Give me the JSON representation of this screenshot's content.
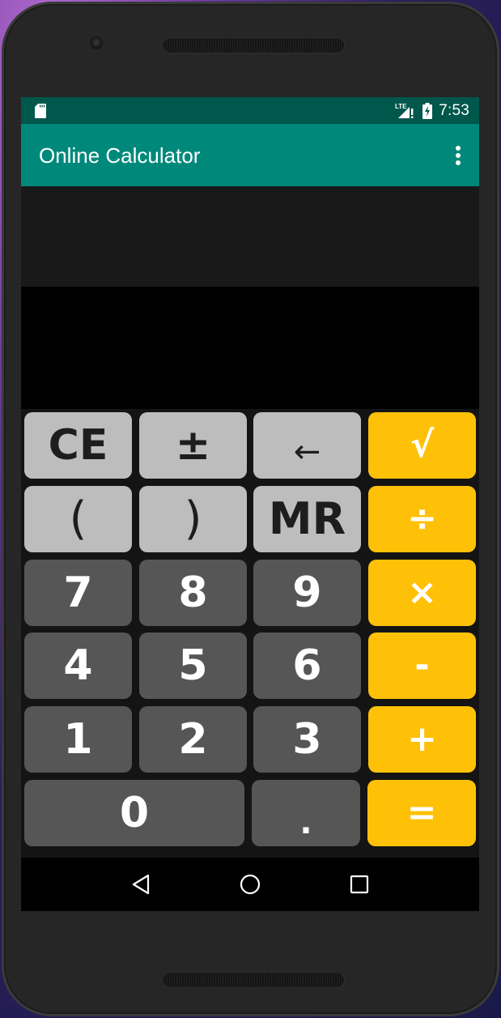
{
  "status_bar": {
    "sd_icon": "sd-card-icon",
    "network_label": "LTE",
    "signal_icon": "signal-no-data-icon",
    "battery_icon": "battery-charging-icon",
    "time": "7:53"
  },
  "app_bar": {
    "title": "Online Calculator",
    "overflow_icon": "more-vert-icon"
  },
  "display": {
    "expression": "",
    "result": ""
  },
  "keypad": {
    "rows": [
      [
        {
          "label": "CE",
          "name": "clear-entry-button",
          "type": "fn"
        },
        {
          "label": "±",
          "name": "plus-minus-button",
          "type": "fn"
        },
        {
          "label": "←",
          "name": "backspace-button",
          "type": "fn"
        },
        {
          "label": "√",
          "name": "square-root-button",
          "type": "op"
        }
      ],
      [
        {
          "label": "(",
          "name": "open-paren-button",
          "type": "fn"
        },
        {
          "label": ")",
          "name": "close-paren-button",
          "type": "fn"
        },
        {
          "label": "MR",
          "name": "memory-recall-button",
          "type": "fn"
        },
        {
          "label": "÷",
          "name": "divide-button",
          "type": "op"
        }
      ],
      [
        {
          "label": "7",
          "name": "digit-7-button",
          "type": "num"
        },
        {
          "label": "8",
          "name": "digit-8-button",
          "type": "num"
        },
        {
          "label": "9",
          "name": "digit-9-button",
          "type": "num"
        },
        {
          "label": "×",
          "name": "multiply-button",
          "type": "op"
        }
      ],
      [
        {
          "label": "4",
          "name": "digit-4-button",
          "type": "num"
        },
        {
          "label": "5",
          "name": "digit-5-button",
          "type": "num"
        },
        {
          "label": "6",
          "name": "digit-6-button",
          "type": "num"
        },
        {
          "label": "-",
          "name": "subtract-button",
          "type": "op"
        }
      ],
      [
        {
          "label": "1",
          "name": "digit-1-button",
          "type": "num"
        },
        {
          "label": "2",
          "name": "digit-2-button",
          "type": "num"
        },
        {
          "label": "3",
          "name": "digit-3-button",
          "type": "num"
        },
        {
          "label": "+",
          "name": "add-button",
          "type": "op"
        }
      ],
      [
        {
          "label": "0",
          "name": "digit-0-button",
          "type": "num"
        },
        {
          "label": ".",
          "name": "decimal-point-button",
          "type": "num"
        },
        {
          "label": "=",
          "name": "equals-button",
          "type": "op"
        }
      ]
    ]
  },
  "nav_bar": {
    "back_icon": "back-triangle-icon",
    "home_icon": "home-circle-icon",
    "recents_icon": "recents-square-icon"
  },
  "colors": {
    "status_bar": "#00574b",
    "app_bar": "#00897b",
    "function_key": "#bdbdbd",
    "number_key": "#565656",
    "operator_key": "#ffc107"
  }
}
